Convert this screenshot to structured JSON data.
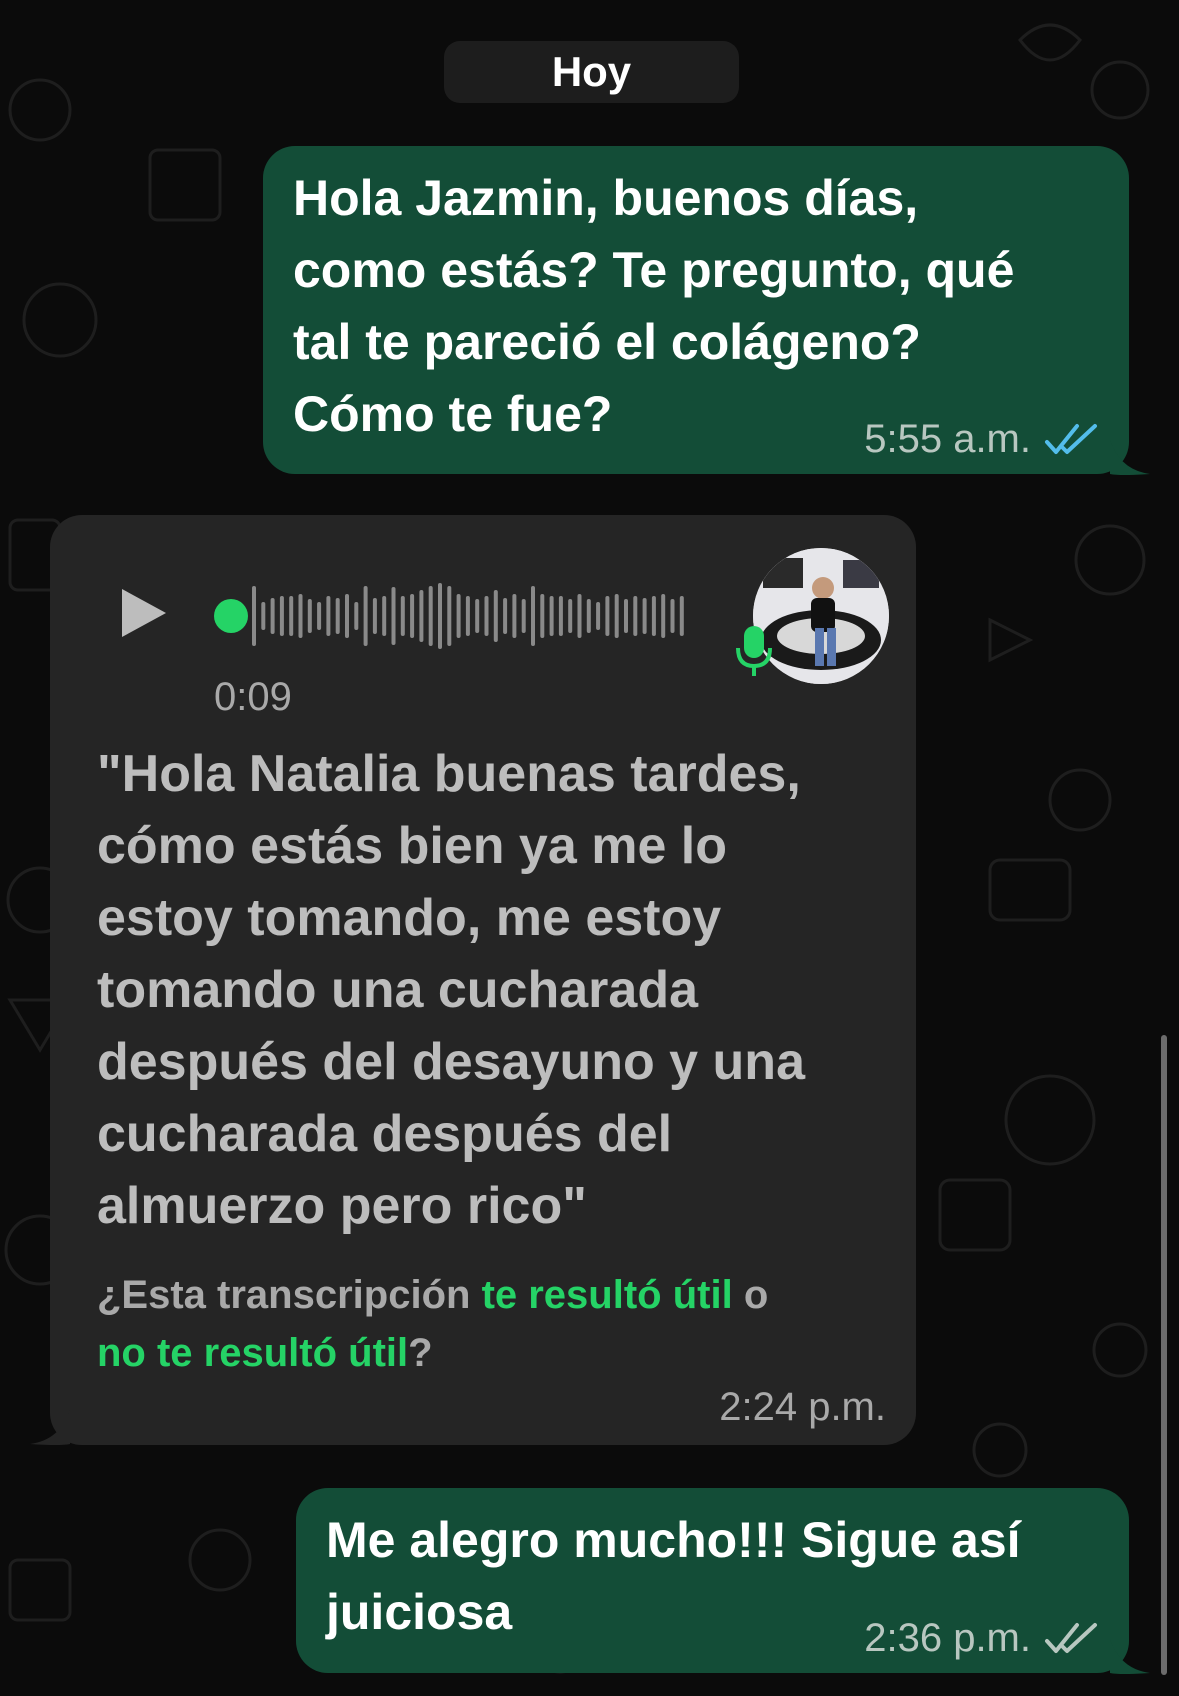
{
  "date_chip": "Hoy",
  "messages": [
    {
      "direction": "outgoing",
      "lines": [
        "Hola Jazmin, buenos días,",
        "como estás? Te pregunto, qué",
        "tal te pareció el colágeno?",
        "Cómo te fue?"
      ],
      "time": "5:55 a.m.",
      "status": "read",
      "status_icon": "double-check-icon",
      "status_color": "#53bdeb"
    },
    {
      "direction": "incoming",
      "type": "voice",
      "duration": "0:09",
      "play_icon": "play-icon",
      "mic_icon": "microphone-icon",
      "transcript_lines": [
        "\"Hola Natalia buenas tardes,",
        "cómo estás bien ya me lo",
        "estoy tomando, me estoy",
        "tomando una cucharada",
        "después del desayuno y una",
        "cucharada después del",
        "almuerzo pero rico\""
      ],
      "feedback_prefix": "¿Esta transcripción ",
      "feedback_useful": "te resultó útil",
      "feedback_or": " o",
      "feedback_not_useful": "no te resultó útil",
      "feedback_suffix": "?",
      "time": "2:24 p.m."
    },
    {
      "direction": "outgoing",
      "lines": [
        "Me alegro mucho!!! Sigue así",
        "juiciosa"
      ],
      "time": "2:36 p.m.",
      "status": "delivered",
      "status_icon": "double-check-icon",
      "status_color": "#b8c7c0"
    }
  ],
  "colors": {
    "background": "#0b0b0b",
    "outgoing_bubble": "#134d37",
    "incoming_bubble": "#252525",
    "accent_green": "#25d366",
    "read_tick_blue": "#53bdeb"
  }
}
